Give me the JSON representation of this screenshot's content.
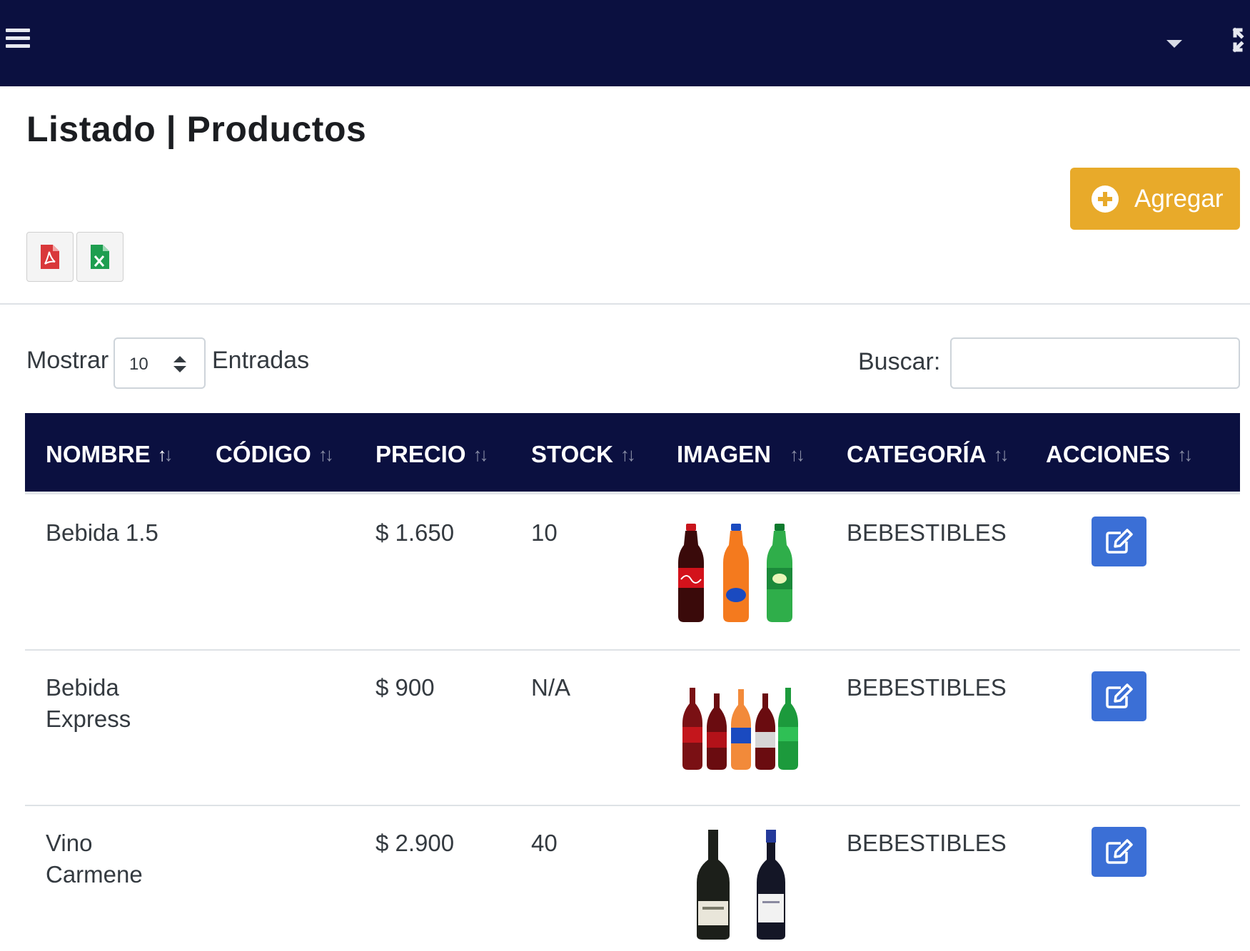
{
  "header": {
    "menu_icon": "hamburger-icon",
    "dropdown_icon": "caret-down-icon",
    "fullscreen_icon": "fullscreen-icon"
  },
  "page": {
    "title": "Listado | Productos"
  },
  "toolbar": {
    "add_label": "Agregar",
    "export_pdf_icon": "pdf-file-icon",
    "export_excel_icon": "excel-file-icon"
  },
  "colors": {
    "navbar": "#0b1040",
    "add_button": "#e8aa2a",
    "edit_button": "#3b6fd6",
    "pdf": "#d9383a",
    "excel": "#1e9e50"
  },
  "length_menu": {
    "label_before": "Mostrar",
    "selected": "10",
    "label_after": "Entradas"
  },
  "search": {
    "label": "Buscar:",
    "value": ""
  },
  "table": {
    "columns": [
      {
        "label": "NOMBRE",
        "sort": "asc"
      },
      {
        "label": "CÓDIGO",
        "sort": "none"
      },
      {
        "label": "PRECIO",
        "sort": "none"
      },
      {
        "label": "STOCK",
        "sort": "none"
      },
      {
        "label": "IMAGEN",
        "sort": "none"
      },
      {
        "label": "CATEGORÍA",
        "sort": "none"
      },
      {
        "label": "ACCIONES",
        "sort": "none"
      }
    ],
    "rows": [
      {
        "nombre": "Bebida 1.5",
        "codigo": "",
        "precio": "$ 1.650",
        "stock": "10",
        "imagen": "soda-bottles-1.5l",
        "categoria": "BEBESTIBLES",
        "accion_icon": "edit-icon"
      },
      {
        "nombre": "Bebida Express",
        "codigo": "",
        "precio": "$ 900",
        "stock": "N/A",
        "imagen": "small-glass-soda-bottles",
        "categoria": "BEBESTIBLES",
        "accion_icon": "edit-icon"
      },
      {
        "nombre": "Vino Carmene",
        "codigo": "",
        "precio": "$ 2.900",
        "stock": "40",
        "imagen": "wine-bottles",
        "categoria": "BEBESTIBLES",
        "accion_icon": "edit-icon"
      }
    ]
  }
}
